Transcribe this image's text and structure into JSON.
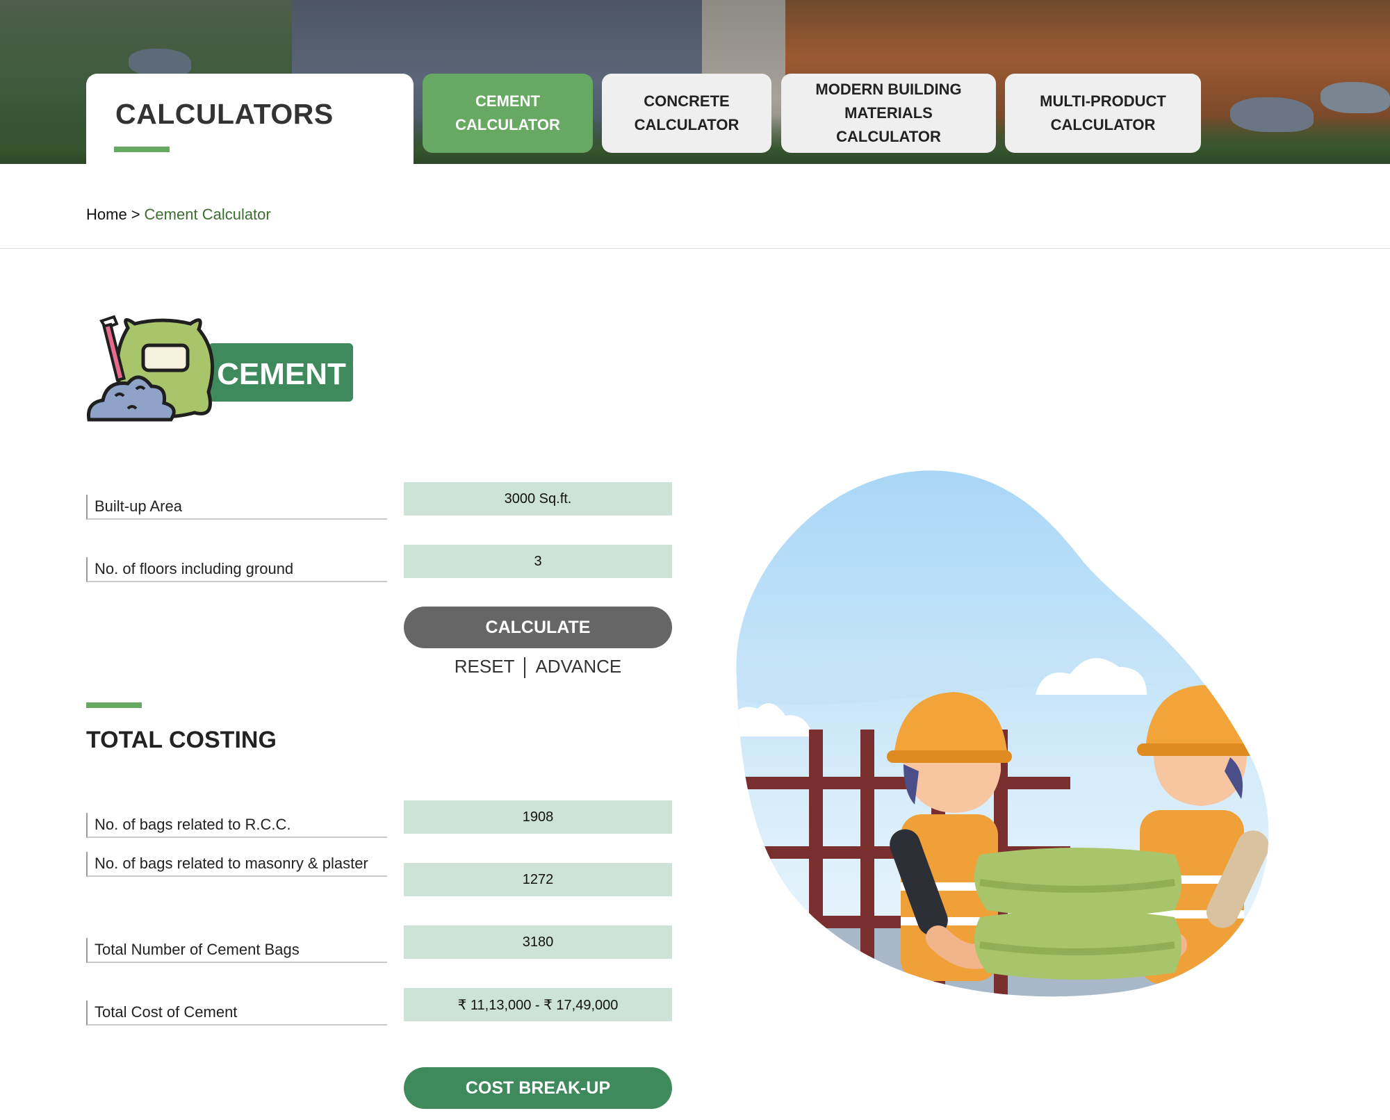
{
  "header": {
    "title": "CALCULATORS",
    "tabs": [
      {
        "line1": "CEMENT",
        "line2": "CALCULATOR",
        "line3": ""
      },
      {
        "line1": "CONCRETE",
        "line2": "CALCULATOR",
        "line3": ""
      },
      {
        "line1": "MODERN BUILDING",
        "line2": "MATERIALS",
        "line3": "CALCULATOR"
      },
      {
        "line1": "MULTI-PRODUCT",
        "line2": "CALCULATOR",
        "line3": ""
      }
    ]
  },
  "breadcrumb": {
    "home": "Home",
    "separator": ">",
    "current": "Cement Calculator"
  },
  "logo": {
    "text": "CEMENT"
  },
  "form": {
    "built_up_label": "Built-up Area",
    "built_up_value": "3000 Sq.ft.",
    "floors_label": "No. of floors including ground",
    "floors_value": "3",
    "calculate_label": "CALCULATE",
    "reset_label": "RESET",
    "advance_label": "ADVANCE"
  },
  "costing": {
    "title": "TOTAL COSTING",
    "rows": [
      {
        "label": "No. of bags related to R.C.C.",
        "value": "1908"
      },
      {
        "label": "No. of bags related to masonry & plaster",
        "value": "1272"
      },
      {
        "label": "Total Number of Cement Bags",
        "value": "3180"
      },
      {
        "label": "Total Cost of Cement",
        "value": "₹ 11,13,000 - ₹ 17,49,000"
      }
    ],
    "breakup_label": "COST BREAK-UP"
  },
  "colors": {
    "accent": "#67a863",
    "field": "#cde3d8",
    "button_dark": "#666666",
    "button_green": "#3f8a5c"
  }
}
